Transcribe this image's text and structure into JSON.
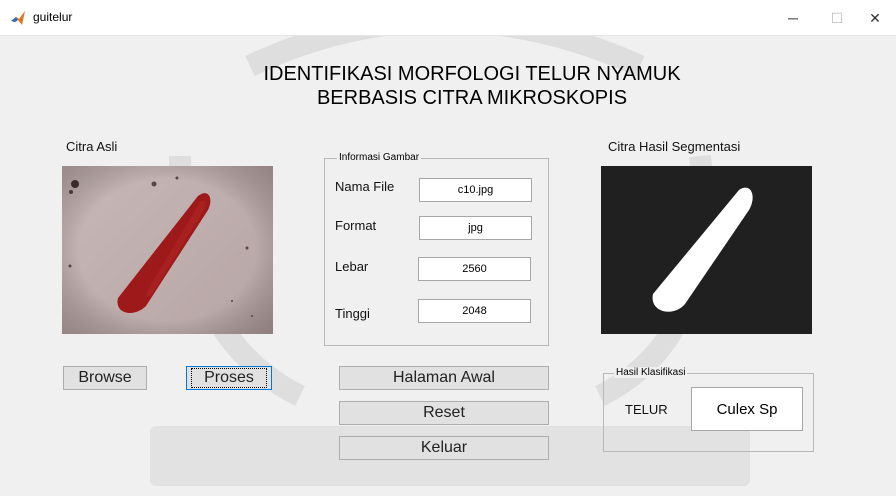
{
  "window": {
    "title": "guitelur",
    "minimize": "─",
    "maximize": "☐",
    "close": "✕"
  },
  "colors": {
    "accent": "#0078d7",
    "background": "#f0f0f0",
    "egg": "#9e1a1a"
  },
  "heading": {
    "line1": "IDENTIFIKASI MORFOLOGI TELUR NYAMUK",
    "line2": "BERBASIS CITRA MIKROSKOPIS"
  },
  "original": {
    "label": "Citra Asli"
  },
  "segmented": {
    "label": "Citra Hasil Segmentasi"
  },
  "info": {
    "title": "Informasi Gambar",
    "rows": [
      {
        "label": "Nama File",
        "value": "c10.jpg"
      },
      {
        "label": "Format",
        "value": "jpg"
      },
      {
        "label": "Lebar",
        "value": "2560"
      },
      {
        "label": "Tinggi",
        "value": "2048"
      }
    ]
  },
  "buttons": {
    "browse": "Browse",
    "process": "Proses",
    "home": "Halaman Awal",
    "reset": "Reset",
    "exit": "Keluar"
  },
  "classification": {
    "title": "Hasil Klasifikasi",
    "label": "TELUR",
    "result": "Culex Sp"
  }
}
